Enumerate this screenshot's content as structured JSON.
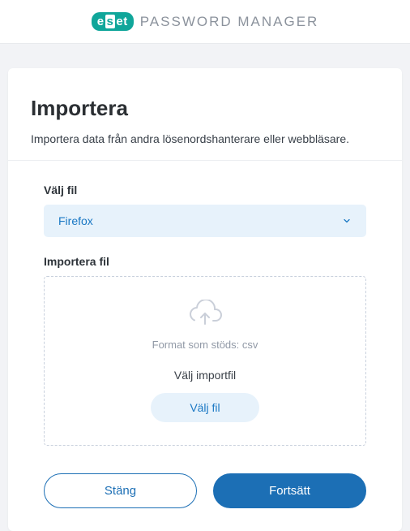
{
  "header": {
    "logo_text": "eset",
    "title": "PASSWORD MANAGER"
  },
  "page": {
    "title": "Importera",
    "description": "Importera data från andra lösenordshanterare eller webbläsare."
  },
  "form": {
    "file_source_label": "Välj fil",
    "file_source_value": "Firefox",
    "import_file_label": "Importera fil",
    "supported_format": "Format som stöds: csv",
    "choose_import_file": "Välj importfil",
    "choose_file_button": "Välj fil"
  },
  "footer": {
    "close": "Stäng",
    "continue": "Fortsätt"
  },
  "colors": {
    "brand_teal": "#10a69a",
    "link_blue": "#1a78c4",
    "primary_blue": "#1c6fb5",
    "soft_blue_bg": "#e7f2fb"
  }
}
